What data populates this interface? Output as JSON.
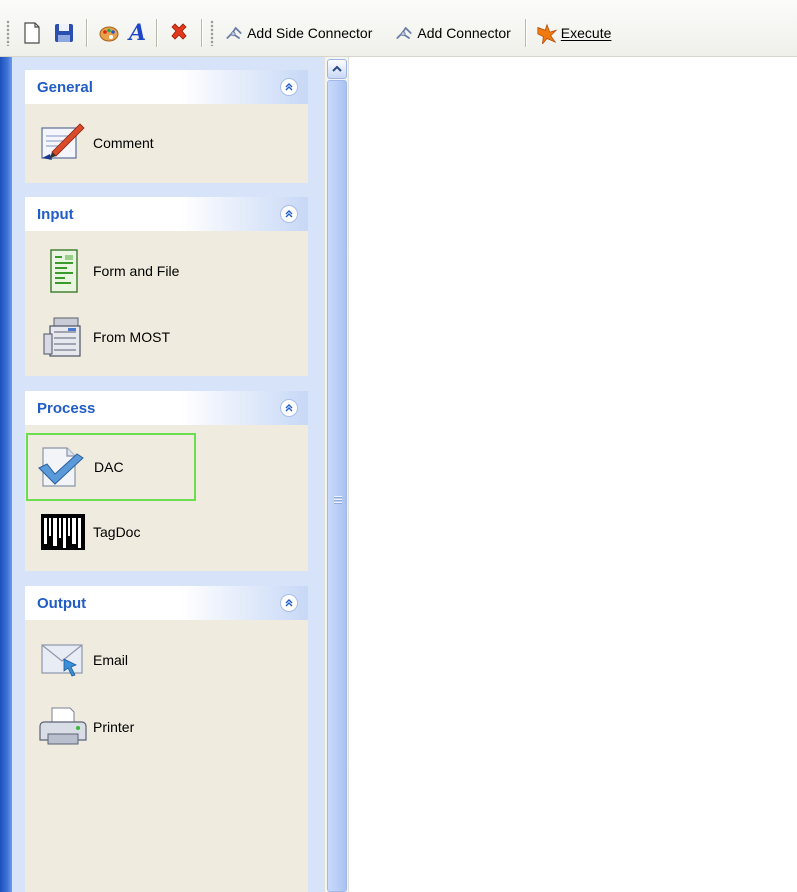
{
  "toolbar": {
    "new_icon": "new-document-icon",
    "save_icon": "save-icon",
    "palette_icon": "palette-icon",
    "font_icon": "font-icon",
    "delete_icon": "delete-icon",
    "font_glyph": "A",
    "add_side_connector_label": "Add Side Connector",
    "add_connector_label": "Add Connector",
    "execute_label": "Execute"
  },
  "sidebar": {
    "groups": [
      {
        "title": "General",
        "items": [
          {
            "label": "Comment",
            "icon": "comment-pen-icon"
          }
        ]
      },
      {
        "title": "Input",
        "items": [
          {
            "label": "Form and File",
            "icon": "form-document-icon"
          },
          {
            "label": "From MOST",
            "icon": "copier-machine-icon"
          }
        ]
      },
      {
        "title": "Process",
        "items": [
          {
            "label": "DAC",
            "icon": "checkmark-document-icon",
            "selected": true
          },
          {
            "label": "TagDoc",
            "icon": "barcode-icon"
          }
        ]
      },
      {
        "title": "Output",
        "items": [
          {
            "label": "Email",
            "icon": "email-envelope-icon"
          },
          {
            "label": "Printer",
            "icon": "printer-icon"
          }
        ]
      }
    ]
  },
  "colors": {
    "group_title": "#215dc6",
    "selection_outline": "#6bdd4f",
    "frame_blue": "#1d4fb8"
  }
}
